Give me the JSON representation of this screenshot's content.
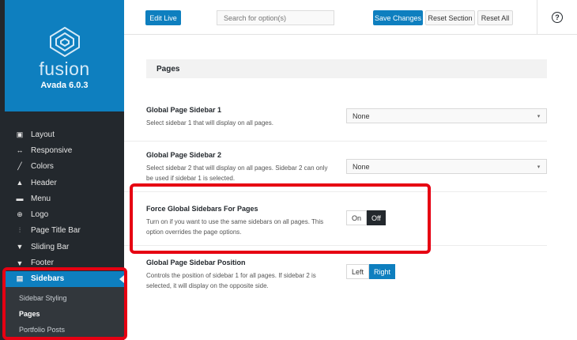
{
  "brand": {
    "logo_text": "fusion",
    "version": "Avada 6.0.3"
  },
  "sidebar": {
    "items": [
      {
        "label": "Layout",
        "icon": "layout-icon"
      },
      {
        "label": "Responsive",
        "icon": "responsive-arrows-icon"
      },
      {
        "label": "Colors",
        "icon": "brush-icon"
      },
      {
        "label": "Header",
        "icon": "arrow-up-icon"
      },
      {
        "label": "Menu",
        "icon": "menu-icon"
      },
      {
        "label": "Logo",
        "icon": "plus-circle-icon"
      },
      {
        "label": "Page Title Bar",
        "icon": "sliders-icon"
      },
      {
        "label": "Sliding Bar",
        "icon": "sliding-bar-icon"
      },
      {
        "label": "Footer",
        "icon": "arrow-down-icon"
      },
      {
        "label": "Sidebars",
        "icon": "sidebar-icon",
        "active": true
      }
    ],
    "submenu": [
      {
        "label": "Sidebar Styling"
      },
      {
        "label": "Pages",
        "current": true
      },
      {
        "label": "Portfolio Posts"
      }
    ]
  },
  "toolbar": {
    "edit_live": "Edit Live",
    "search_placeholder": "Search for option(s)",
    "save_changes": "Save Changes",
    "reset_section": "Reset Section",
    "reset_all": "Reset All",
    "help": "?"
  },
  "section": {
    "title": "Pages"
  },
  "options": {
    "sidebar1": {
      "title": "Global Page Sidebar 1",
      "desc": "Select sidebar 1 that will display on all pages.",
      "value": "None"
    },
    "sidebar2": {
      "title": "Global Page Sidebar 2",
      "desc": "Select sidebar 2 that will display on all pages. Sidebar 2 can only be used if sidebar 1 is selected.",
      "value": "None"
    },
    "force": {
      "title": "Force Global Sidebars For Pages",
      "desc": "Turn on if you want to use the same sidebars on all pages. This option overrides the page options.",
      "on": "On",
      "off": "Off",
      "selected": "Off"
    },
    "position": {
      "title": "Global Page Sidebar Position",
      "desc": "Controls the position of sidebar 1 for all pages. If sidebar 2 is selected, it will display on the opposite side.",
      "left": "Left",
      "right": "Right",
      "selected": "Right"
    }
  },
  "colors": {
    "accent": "#0e7fbf",
    "sidebar_bg": "#23282d",
    "highlight": "#e60012"
  }
}
